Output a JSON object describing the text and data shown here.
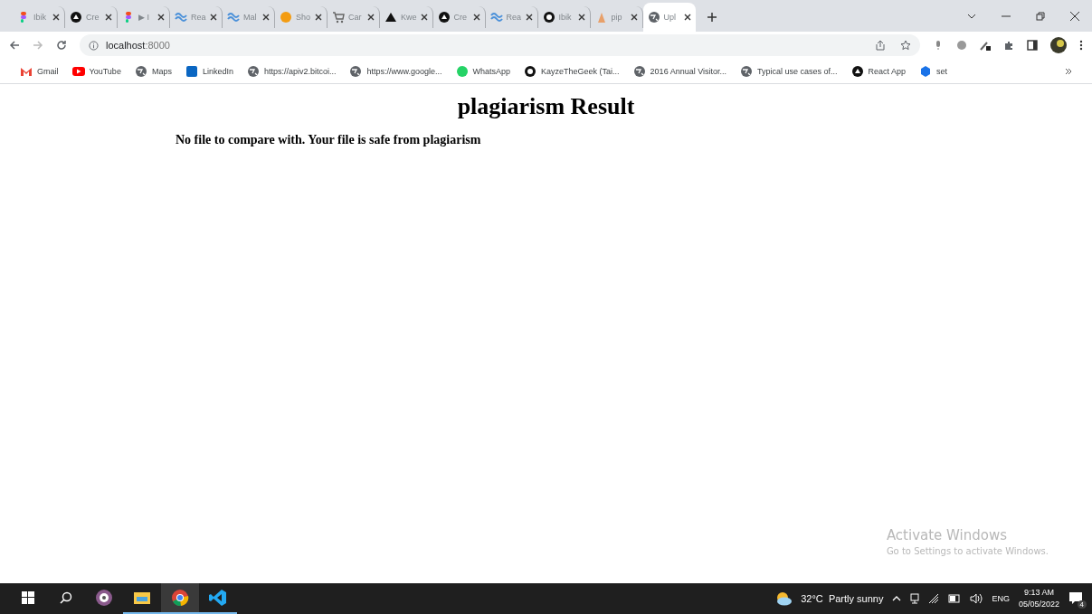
{
  "tabs": [
    {
      "title": "Ibik",
      "kind": "figma",
      "selected": false
    },
    {
      "title": "Cre",
      "kind": "dark",
      "selected": false
    },
    {
      "title": "▶ I",
      "kind": "figma",
      "selected": false
    },
    {
      "title": "Rea",
      "kind": "wave",
      "selected": false
    },
    {
      "title": "Mal",
      "kind": "wave",
      "selected": false
    },
    {
      "title": "Sho",
      "kind": "orange",
      "selected": false
    },
    {
      "title": "Car",
      "kind": "cart",
      "selected": false
    },
    {
      "title": "Kwe",
      "kind": "triangle",
      "selected": false
    },
    {
      "title": "Cre",
      "kind": "dark",
      "selected": false
    },
    {
      "title": "Rea",
      "kind": "wave",
      "selected": false
    },
    {
      "title": "Ibik",
      "kind": "github",
      "selected": false
    },
    {
      "title": "pip",
      "kind": "pip",
      "selected": false
    },
    {
      "title": "Upl",
      "kind": "globe",
      "selected": true
    }
  ],
  "address": {
    "host": "localhost",
    "port": ":8000"
  },
  "bookmarks": [
    {
      "title": "Gmail",
      "kind": "gmail"
    },
    {
      "title": "YouTube",
      "kind": "youtube"
    },
    {
      "title": "Maps",
      "kind": "globe"
    },
    {
      "title": "LinkedIn",
      "kind": "linkedin"
    },
    {
      "title": "https://apiv2.bitcoi...",
      "kind": "globe"
    },
    {
      "title": "https://www.google...",
      "kind": "globe"
    },
    {
      "title": "WhatsApp",
      "kind": "whatsapp"
    },
    {
      "title": "KayzeTheGeek (Tai...",
      "kind": "github"
    },
    {
      "title": "2016 Annual Visitor...",
      "kind": "globe"
    },
    {
      "title": "Typical use cases of...",
      "kind": "globe"
    },
    {
      "title": "React App",
      "kind": "dark"
    },
    {
      "title": "set",
      "kind": "blue"
    }
  ],
  "page": {
    "heading": "plagiarism Result",
    "message": "No file to compare with. Your file is safe from plagiarism"
  },
  "activation": {
    "title": "Activate Windows",
    "hint": "Go to Settings to activate Windows."
  },
  "taskbar": {
    "apps": [
      {
        "kind": "camera",
        "running": false,
        "selected": false
      },
      {
        "kind": "folder",
        "running": true,
        "selected": false
      },
      {
        "kind": "chrome",
        "running": true,
        "selected": true
      },
      {
        "kind": "vscode",
        "running": true,
        "selected": false
      }
    ],
    "weather": "32°C  Partly sunny",
    "language": "ENG",
    "time": "9:13 AM",
    "date": "05/05/2022",
    "notifications": "4"
  }
}
